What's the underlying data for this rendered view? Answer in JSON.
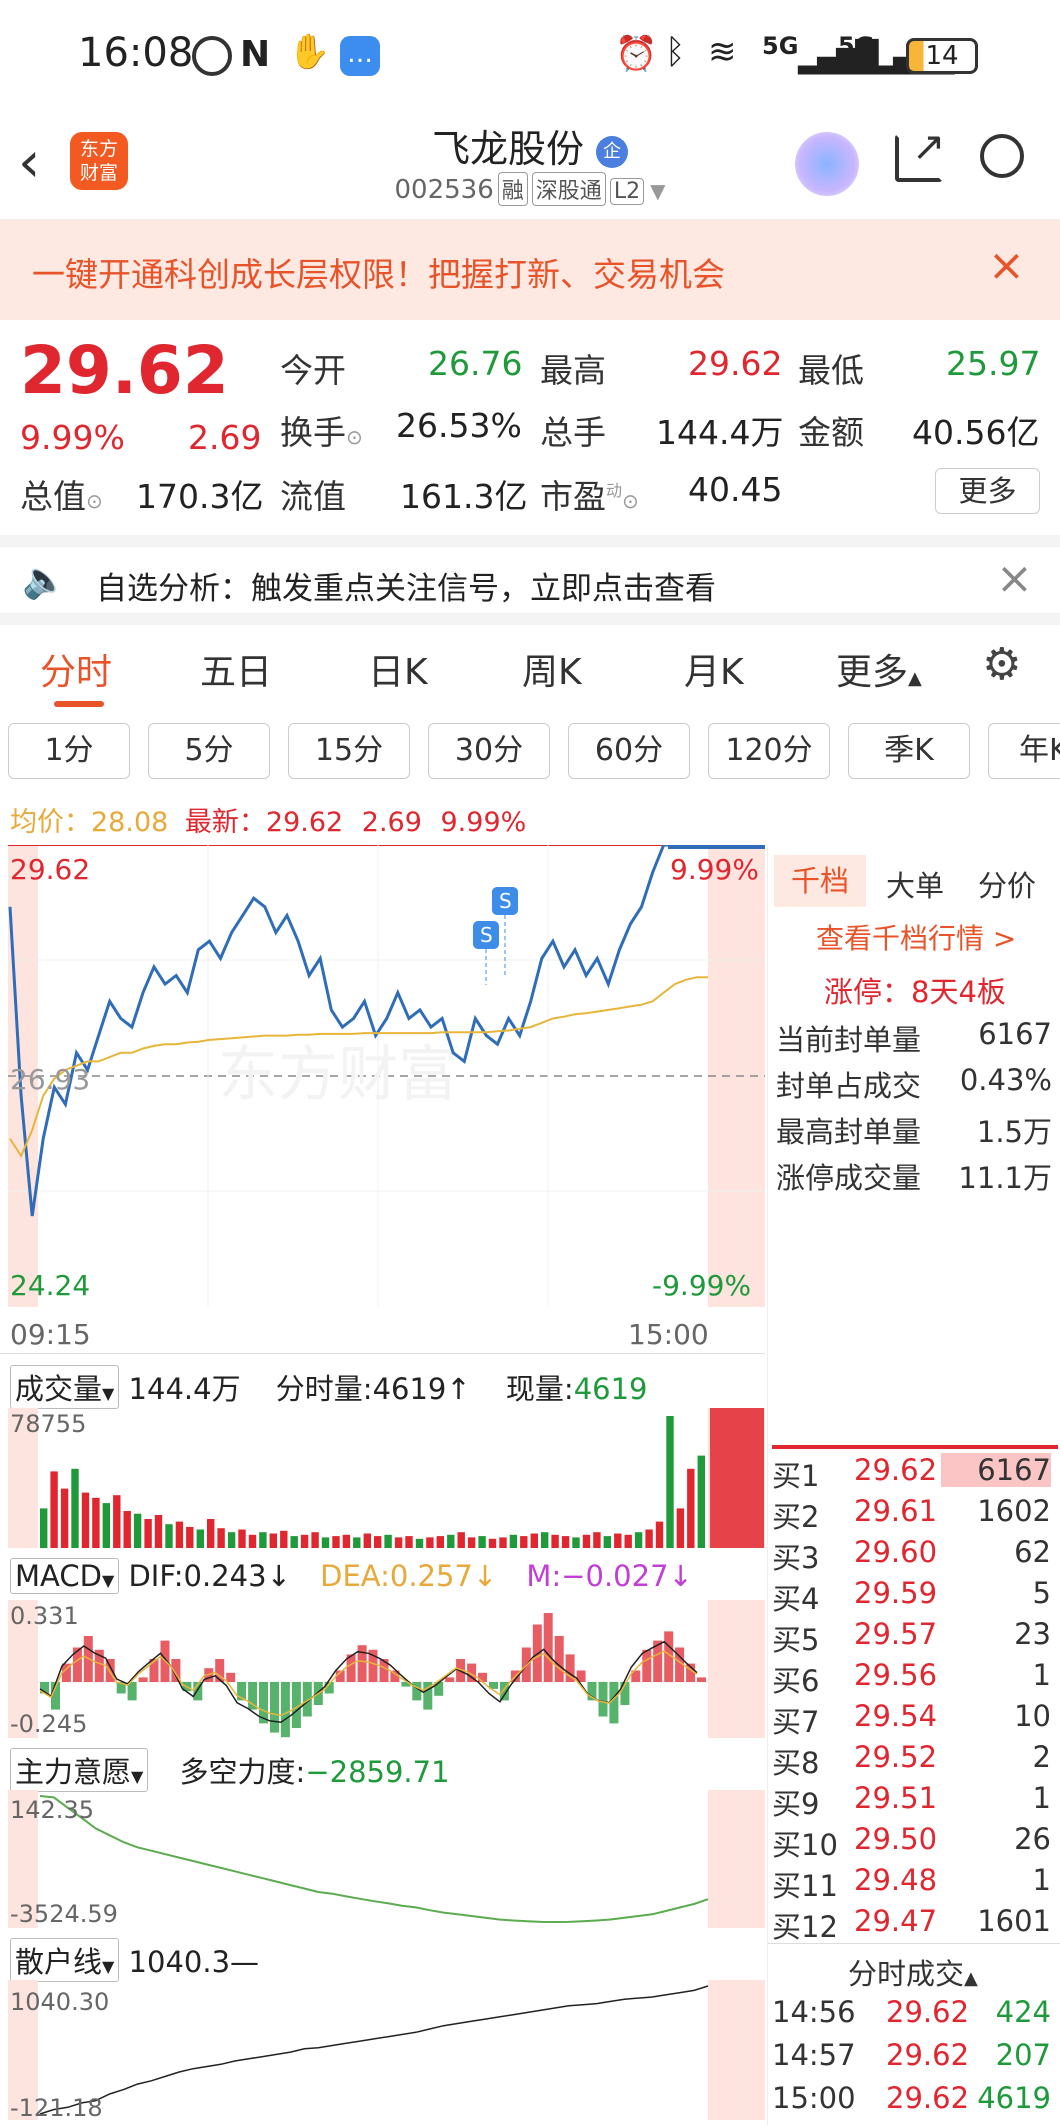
{
  "status_bar": {
    "time": "16:08",
    "network1": "5G",
    "network2": "5G",
    "battery": "14"
  },
  "header": {
    "logo_text": "东方\n财富",
    "title": "飞龙股份",
    "badge": "企",
    "code": "002536",
    "tags": [
      "融",
      "深股通",
      "L2"
    ]
  },
  "banner": {
    "text": "一键开通科创成长层权限！把握打新、交易机会"
  },
  "quote": {
    "price": "29.62",
    "change_pct": "9.99%",
    "change": "2.69",
    "open_label": "今开",
    "open": "26.76",
    "high_label": "最高",
    "high": "29.62",
    "low_label": "最低",
    "low": "25.97",
    "turnover_label": "换手",
    "turnover": "26.53%",
    "volume_label": "总手",
    "volume": "144.4万",
    "amount_label": "金额",
    "amount": "40.56亿",
    "mktcap_label": "总值",
    "mktcap": "170.3亿",
    "float_label": "流值",
    "float": "161.3亿",
    "pe_label": "市盈",
    "pe_sup": "动",
    "pe": "40.45",
    "more": "更多"
  },
  "notice": {
    "text": "自选分析：触发重点关注信号，立即点击查看"
  },
  "tabs": [
    "分时",
    "五日",
    "日K",
    "周K",
    "月K",
    "更多"
  ],
  "subtabs": [
    "1分",
    "5分",
    "15分",
    "30分",
    "60分",
    "120分",
    "季K",
    "年K"
  ],
  "legend": {
    "avg_label": "均价：",
    "avg": "28.08",
    "last_label": "最新：",
    "last": "29.62",
    "chg": "2.69",
    "pct": "9.99%"
  },
  "chart_data": [
    {
      "type": "line",
      "title": "",
      "x_start": "09:15",
      "x_end": "15:00",
      "y_top_label": "29.62",
      "y_mid_label": "26.93",
      "y_bottom_label": "24.24",
      "right_top_label": "9.99%",
      "right_bottom_label": "-9.99%",
      "ylim": [
        24.24,
        29.62
      ],
      "series": [
        {
          "name": "",
          "values": [
            28.9,
            26.7,
            25.3,
            26.2,
            26.8,
            26.6,
            27.2,
            27.0,
            27.4,
            27.8,
            27.6,
            27.5,
            27.9,
            28.2,
            28.0,
            28.1,
            27.9,
            28.4,
            28.5,
            28.3,
            28.6,
            28.8,
            29.0,
            28.9,
            28.6,
            28.8,
            28.5,
            28.1,
            28.3,
            27.7,
            27.5,
            27.6,
            27.8,
            27.4,
            27.6,
            27.9,
            27.6,
            27.7,
            27.5,
            27.6,
            27.2,
            27.1,
            27.6,
            27.4,
            27.3,
            27.6,
            27.4,
            27.8,
            28.3,
            28.5,
            28.2,
            28.4,
            28.1,
            28.3,
            28.0,
            28.4,
            28.7,
            28.9,
            29.3,
            29.62,
            29.62,
            29.62,
            29.62,
            29.62
          ]
        },
        {
          "name": "均价",
          "values": [
            26.2,
            26.0,
            26.3,
            26.7,
            26.9,
            27.0,
            27.05,
            27.1,
            27.1,
            27.15,
            27.2,
            27.2,
            27.25,
            27.28,
            27.3,
            27.3,
            27.32,
            27.33,
            27.35,
            27.36,
            27.37,
            27.38,
            27.39,
            27.4,
            27.4,
            27.4,
            27.41,
            27.41,
            27.42,
            27.42,
            27.42,
            27.42,
            27.43,
            27.43,
            27.43,
            27.43,
            27.43,
            27.43,
            27.43,
            27.44,
            27.44,
            27.44,
            27.44,
            27.44,
            27.45,
            27.46,
            27.48,
            27.5,
            27.55,
            27.6,
            27.62,
            27.65,
            27.66,
            27.68,
            27.7,
            27.72,
            27.74,
            27.76,
            27.8,
            27.9,
            28.0,
            28.05,
            28.08,
            28.08
          ]
        }
      ]
    },
    {
      "type": "bar",
      "title": "成交量",
      "ymax_label": "78755",
      "values": [
        30,
        58,
        45,
        60,
        42,
        38,
        34,
        40,
        28,
        26,
        22,
        25,
        18,
        20,
        16,
        14,
        22,
        15,
        12,
        14,
        10,
        12,
        11,
        13,
        9,
        10,
        12,
        8,
        9,
        10,
        8,
        11,
        9,
        10,
        8,
        9,
        7,
        8,
        9,
        10,
        12,
        8,
        9,
        7,
        8,
        10,
        9,
        11,
        12,
        10,
        9,
        8,
        10,
        12,
        9,
        11,
        10,
        12,
        14,
        20,
        100,
        30,
        60,
        70
      ]
    },
    {
      "type": "bar",
      "title": "MACD",
      "ymax_label": "0.331",
      "ymin_label": "-0.245",
      "values": [
        -0.05,
        -0.12,
        0.08,
        0.15,
        0.2,
        0.14,
        0.1,
        -0.05,
        -0.08,
        0.02,
        0.1,
        0.18,
        0.1,
        -0.04,
        -0.08,
        0.06,
        0.1,
        0.04,
        -0.08,
        -0.12,
        -0.18,
        -0.22,
        -0.24,
        -0.2,
        -0.15,
        -0.1,
        -0.05,
        0.05,
        0.12,
        0.16,
        0.14,
        0.1,
        0.05,
        -0.02,
        -0.08,
        -0.12,
        -0.06,
        0.02,
        0.1,
        0.08,
        0.04,
        -0.03,
        -0.08,
        0.05,
        0.15,
        0.25,
        0.3,
        0.2,
        0.12,
        0.05,
        -0.08,
        -0.15,
        -0.18,
        -0.1,
        0.05,
        0.14,
        0.18,
        0.22,
        0.15,
        0.08,
        0.02
      ]
    },
    {
      "type": "line",
      "title": "主力意愿",
      "ymax_label": "142.35",
      "ymin_label": "-3524.59",
      "values": [
        142,
        100,
        -200,
        -500,
        -800,
        -1000,
        -1200,
        -1350,
        -1450,
        -1550,
        -1650,
        -1750,
        -1850,
        -1950,
        -2050,
        -2150,
        -2250,
        -2350,
        -2450,
        -2550,
        -2650,
        -2700,
        -2780,
        -2850,
        -2920,
        -2980,
        -3050,
        -3100,
        -3180,
        -3250,
        -3300,
        -3350,
        -3400,
        -3450,
        -3480,
        -3500,
        -3520,
        -3524,
        -3520,
        -3500,
        -3480,
        -3450,
        -3400,
        -3350,
        -3300,
        -3200,
        -3100,
        -3000,
        -2860
      ]
    },
    {
      "type": "line",
      "title": "散户线",
      "ymax_label": "1040.30",
      "ymin_label": "-121.18",
      "values": [
        -121,
        -80,
        -60,
        -20,
        0,
        60,
        100,
        150,
        180,
        220,
        260,
        290,
        310,
        330,
        360,
        380,
        400,
        420,
        440,
        470,
        480,
        500,
        520,
        540,
        560,
        580,
        600,
        620,
        650,
        680,
        700,
        720,
        740,
        760,
        780,
        800,
        820,
        840,
        860,
        870,
        880,
        900,
        920,
        930,
        940,
        960,
        980,
        1000,
        1040
      ]
    }
  ],
  "volume_panel": {
    "label": "成交量",
    "total": "144.4万",
    "tick_label": "分时量:",
    "tick": "4619",
    "cur_label": "现量:",
    "cur": "4619"
  },
  "macd_panel": {
    "label": "MACD",
    "dif": "DIF:0.243",
    "dea": "DEA:0.257",
    "m": "M:−0.027"
  },
  "main_panel": {
    "label": "主力意愿",
    "dkp_label": "多空力度:",
    "dkp": "−2859.71"
  },
  "retail_panel": {
    "label": "散户线",
    "value": "1040.3"
  },
  "right": {
    "tabs": [
      "千档",
      "大单",
      "分价"
    ],
    "link": "查看千档行情 >",
    "limit": "涨停：8天4板",
    "rows": [
      {
        "label": "当前封单量",
        "value": "6167"
      },
      {
        "label": "封单占成交",
        "value": "0.43%"
      },
      {
        "label": "最高封单量",
        "value": "1.5万"
      },
      {
        "label": "涨停成交量",
        "value": "11.1万"
      }
    ],
    "orderbook": [
      {
        "label": "买1",
        "price": "29.62",
        "vol": "6167"
      },
      {
        "label": "买2",
        "price": "29.61",
        "vol": "1602"
      },
      {
        "label": "买3",
        "price": "29.60",
        "vol": "62"
      },
      {
        "label": "买4",
        "price": "29.59",
        "vol": "5"
      },
      {
        "label": "买5",
        "price": "29.57",
        "vol": "23"
      },
      {
        "label": "买6",
        "price": "29.56",
        "vol": "1"
      },
      {
        "label": "买7",
        "price": "29.54",
        "vol": "10"
      },
      {
        "label": "买8",
        "price": "29.52",
        "vol": "2"
      },
      {
        "label": "买9",
        "price": "29.51",
        "vol": "1"
      },
      {
        "label": "买10",
        "price": "29.50",
        "vol": "26"
      },
      {
        "label": "买11",
        "price": "29.48",
        "vol": "1"
      },
      {
        "label": "买12",
        "price": "29.47",
        "vol": "1601"
      }
    ],
    "trades_title": "分时成交",
    "trades": [
      {
        "time": "14:56",
        "price": "29.62",
        "vol": "424"
      },
      {
        "time": "14:57",
        "price": "29.62",
        "vol": "207"
      },
      {
        "time": "15:00",
        "price": "29.62",
        "vol": "4619"
      }
    ]
  }
}
